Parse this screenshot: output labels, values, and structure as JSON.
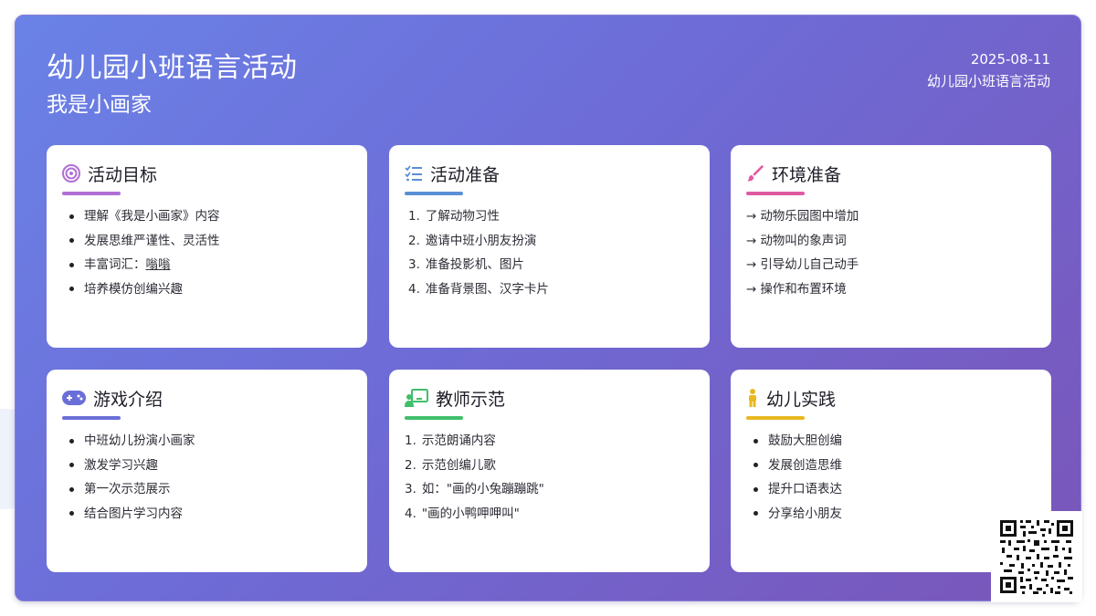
{
  "header": {
    "title": "幼儿园小班语言活动",
    "subtitle": "我是小画家",
    "date": "2025-08-11",
    "meta_label": "幼儿园小班语言活动"
  },
  "cards": [
    {
      "title": "活动目标",
      "icon": "target-icon",
      "accent": "#b06fd6",
      "items": [
        "理解《我是小画家》内容",
        "发展思维严谨性、灵活性",
        "丰富词汇：",
        "培养模仿创编兴趣"
      ],
      "vocab_word": "嗡嗡"
    },
    {
      "title": "活动准备",
      "icon": "checklist-icon",
      "accent": "#5a8fd6",
      "items": [
        "了解动物习性",
        "邀请中班小朋友扮演",
        "准备投影机、图片",
        "准备背景图、汉字卡片"
      ]
    },
    {
      "title": "环境准备",
      "icon": "paintbrush-icon",
      "accent": "#e05aa0",
      "items": [
        "动物乐园图中增加",
        "动物叫的象声词",
        "引导幼儿自己动手",
        "操作和布置环境"
      ]
    },
    {
      "title": "游戏介绍",
      "icon": "gamepad-icon",
      "accent": "#6a6fd8",
      "items": [
        "中班幼儿扮演小画家",
        "激发学习兴趣",
        "第一次示范展示",
        "结合图片学习内容"
      ]
    },
    {
      "title": "教师示范",
      "icon": "teacher-board-icon",
      "accent": "#3fbf6a",
      "items": [
        "示范朗诵内容",
        "示范创编儿歌",
        "如：\"画的小兔蹦蹦跳\"",
        "\"画的小鸭呷呷叫\""
      ]
    },
    {
      "title": "幼儿实践",
      "icon": "child-icon",
      "accent": "#e8b820",
      "items": [
        "鼓励大胆创编",
        "发展创造思维",
        "提升口语表达",
        "分享给小朋友"
      ]
    }
  ],
  "markers": {
    "numbers": [
      "1.",
      "2.",
      "3.",
      "4."
    ],
    "arrow": "→"
  },
  "qr": {
    "icon": "qr-code-icon"
  }
}
